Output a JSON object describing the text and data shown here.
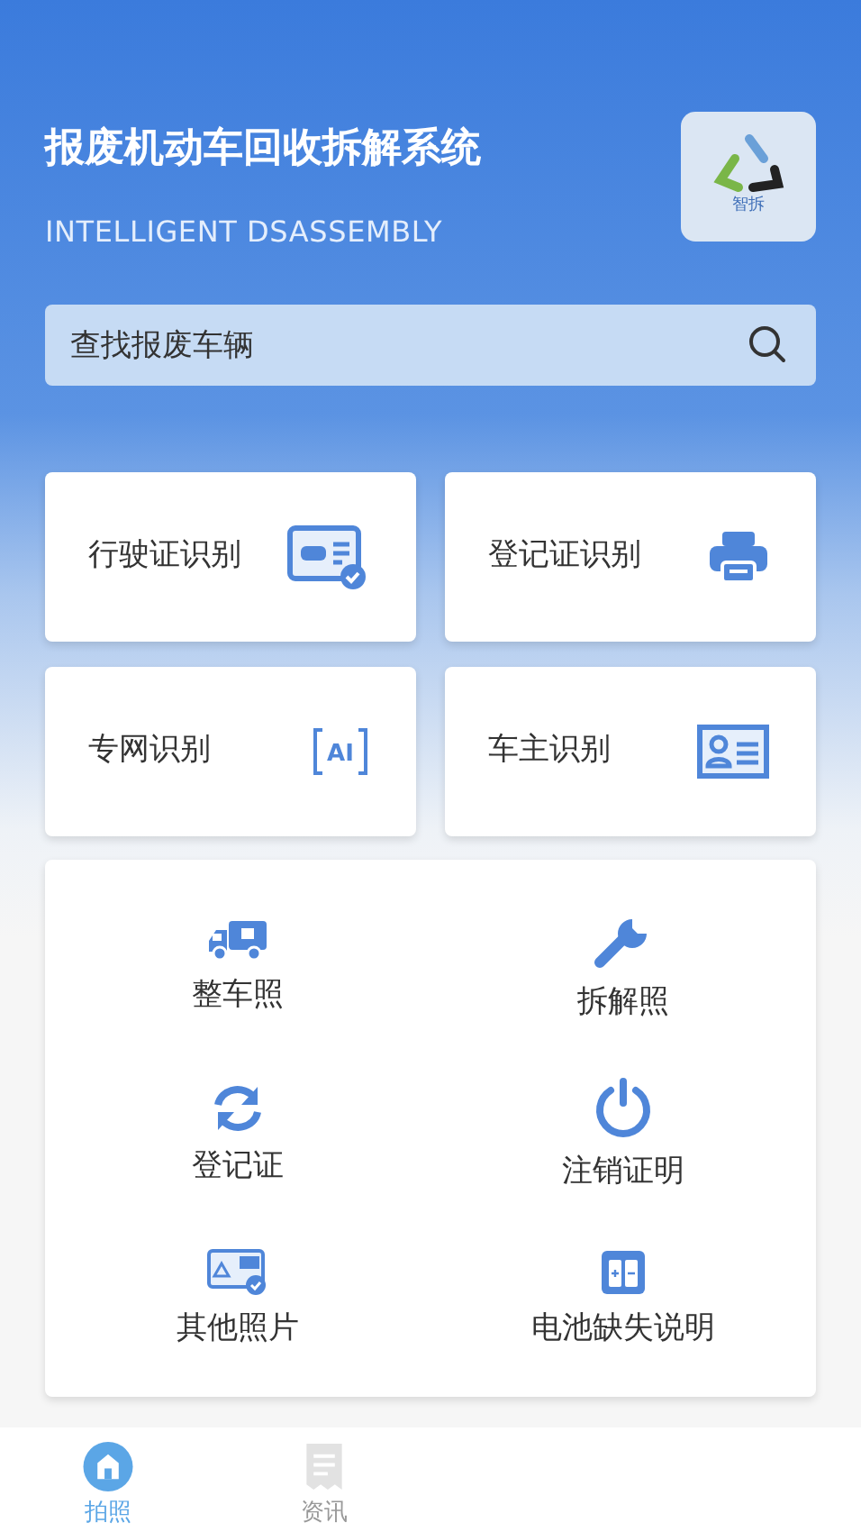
{
  "header": {
    "title": "报废机动车回收拆解系统",
    "subtitle": "INTELLIGENT DSASSEMBLY",
    "logo_text": "智拆"
  },
  "search": {
    "placeholder": "查找报废车辆"
  },
  "recognition_cards": [
    {
      "label": "行驶证识别"
    },
    {
      "label": "登记证识别"
    },
    {
      "label": "专网识别",
      "icon_text": "AI"
    },
    {
      "label": "车主识别"
    }
  ],
  "photo_items": [
    {
      "label": "整车照"
    },
    {
      "label": "拆解照"
    },
    {
      "label": "登记证"
    },
    {
      "label": "注销证明"
    },
    {
      "label": "其他照片"
    },
    {
      "label": "电池缺失说明"
    }
  ],
  "bottom_tabs": [
    {
      "label": "拍照",
      "selected": true
    },
    {
      "label": "资讯",
      "selected": false
    }
  ]
}
